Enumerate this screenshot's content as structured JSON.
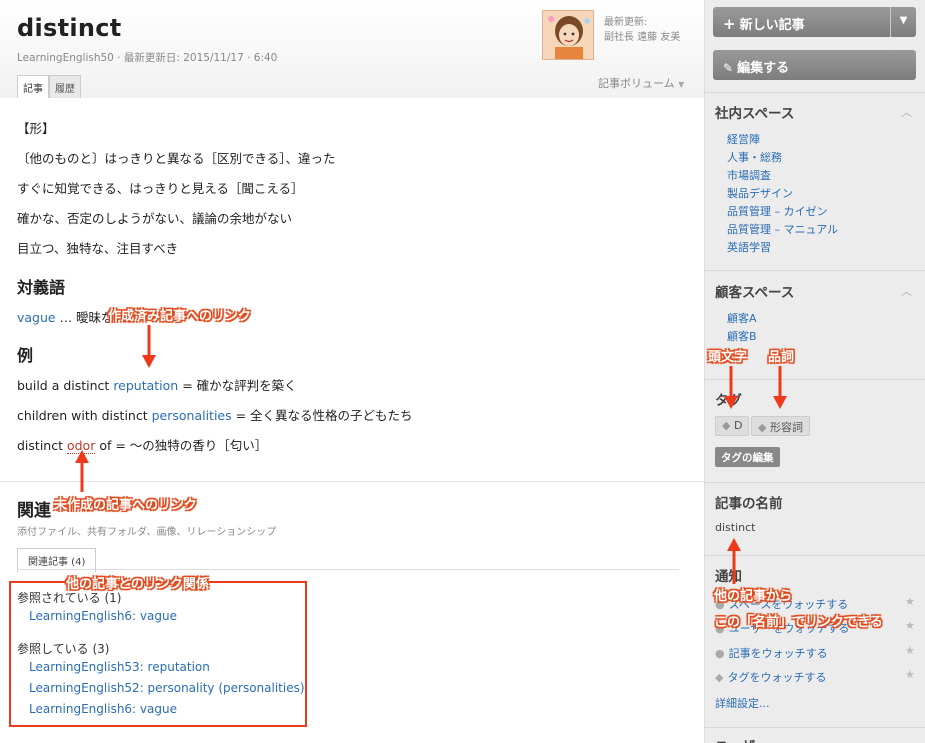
{
  "article": {
    "title": "distinct",
    "meta": "LearningEnglish50 · 最新更新日: 2015/11/17 · 6:40",
    "updated_label": "最新更新:",
    "updated_user": "副社長 遠藤 友美",
    "tabs": [
      "記事",
      "履歴"
    ],
    "volume": "記事ボリューム"
  },
  "content": {
    "pos": "【形】",
    "defs": [
      "〔他のものと〕はっきりと異なる［区別できる］、違った",
      "すぐに知覚できる、はっきりと見える［聞こえる］",
      "確かな、否定のしようがない、議論の余地がない",
      "目立つ、独特な、注目すべき"
    ],
    "antonym_heading": "対義語",
    "antonym_link": "vague",
    "antonym_rest": " … 曖昧な",
    "example_heading": "例",
    "examples": [
      {
        "pre": "build a distinct ",
        "link": "reputation",
        "post": " = 確かな評判を築く"
      },
      {
        "pre": "children with distinct ",
        "link": "personalities",
        "post": " = 全く異なる性格の子どもたち"
      },
      {
        "pre": "distinct ",
        "link": "odor",
        "post": " of = 〜の独特の香り［匂い］"
      }
    ]
  },
  "related": {
    "heading": "関連",
    "subtitle": "添付ファイル、共有フォルダ、画像、リレーションシップ",
    "tab": "関連記事 (4)",
    "referenced_label": "参照されている (1)",
    "referenced": [
      "LearningEnglish6: vague"
    ],
    "referencing_label": "参照している (3)",
    "referencing": [
      "LearningEnglish53: reputation",
      "LearningEnglish52: personality (personalities)",
      "LearningEnglish6: vague"
    ]
  },
  "sidebar": {
    "new_article": "新しい記事",
    "edit": "編集する",
    "internal_title": "社内スペース",
    "internal_spaces": [
      "経営陣",
      "人事・総務",
      "市場調査",
      "製品デザイン",
      "品質管理 – カイゼン",
      "品質管理 – マニュアル",
      "英語学習"
    ],
    "customer_title": "顧客スペース",
    "customer_spaces": [
      "顧客A",
      "顧客B"
    ],
    "tags_title": "タグ",
    "tags": [
      "D",
      "形容詞"
    ],
    "tag_edit": "タグの編集",
    "name_title": "記事の名前",
    "name_value": "distinct",
    "notify_title": "通知",
    "watch": [
      "スペースをウォッチする",
      "ユーザーをウォッチする",
      "記事をウォッチする",
      "タグをウォッチする"
    ],
    "details": "詳細設定...",
    "bottom_title": "ユーザー"
  },
  "annotations": {
    "created_link": "作成済み記事へのリンク",
    "uncreated_link": "未作成の記事へのリンク",
    "link_relation": "他の記事とのリンク関係",
    "initial": "頭文字",
    "pos": "品詞",
    "name_link_1": "他の記事から",
    "name_link_2": "この「名前」でリンクできる"
  },
  "colors": {
    "link": "#2a6db5",
    "annotation": "#e24b1e",
    "broken_link": "#c0392b"
  }
}
